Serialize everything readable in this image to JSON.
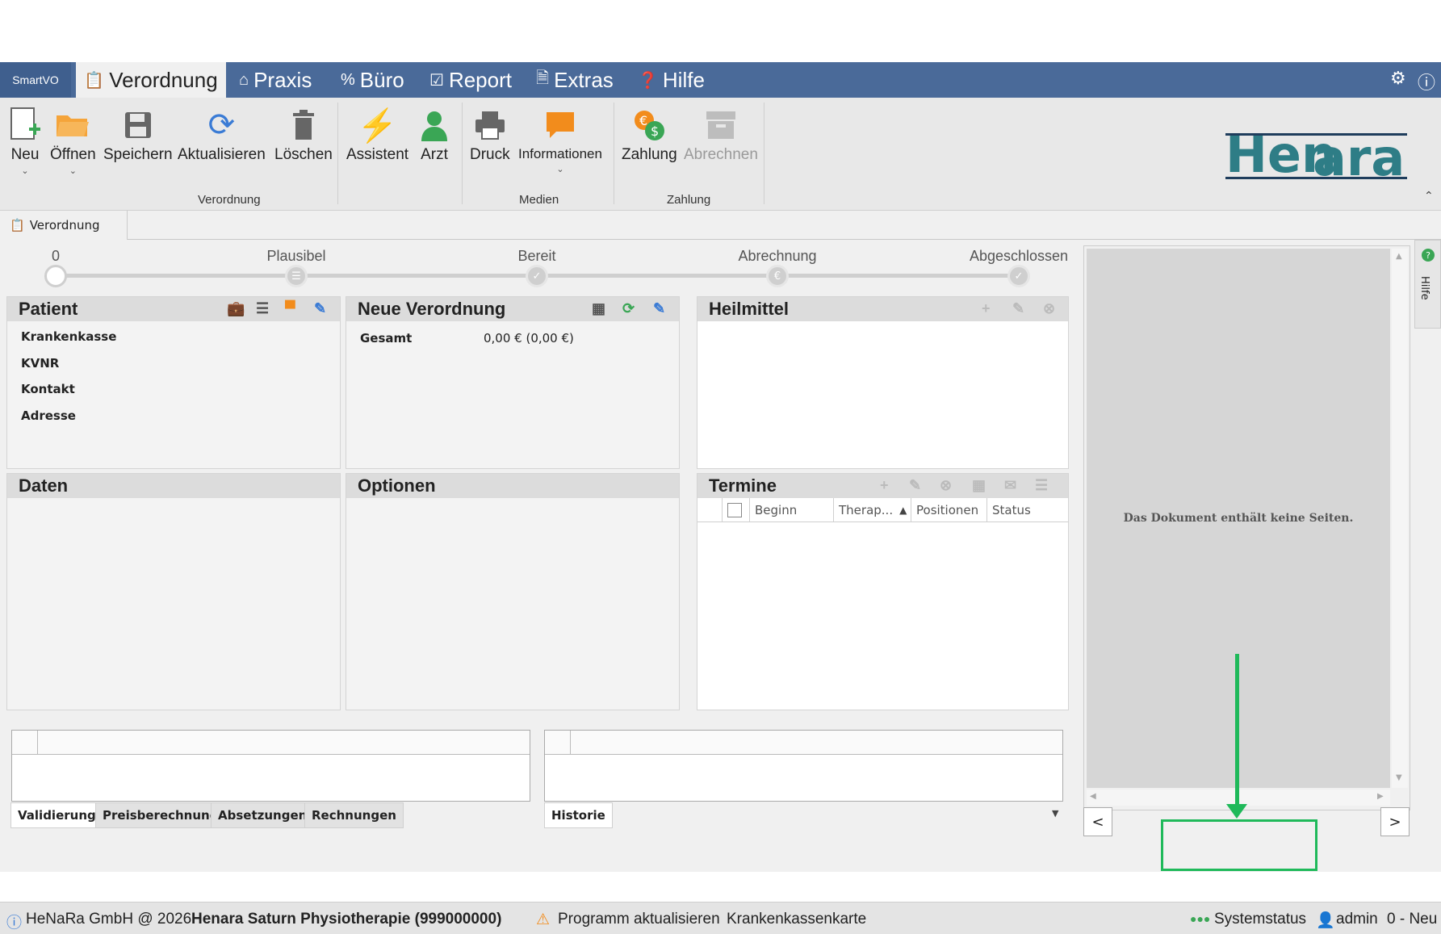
{
  "menubar": {
    "smartvo": "SmartVO",
    "tabs": [
      {
        "label": "Verordnung",
        "icon": "clipboard-icon"
      },
      {
        "label": "Praxis",
        "icon": "home-icon"
      },
      {
        "label": "Büro",
        "icon": "percent-icon"
      },
      {
        "label": "Report",
        "icon": "clipboard-check-icon"
      },
      {
        "label": "Extras",
        "icon": "document-search-icon"
      },
      {
        "label": "Hilfe",
        "icon": "help-icon"
      }
    ],
    "right_icons": [
      "gear-icon",
      "info-icon"
    ]
  },
  "ribbon": {
    "buttons": [
      {
        "label": "Neu",
        "icon": "new-document-icon"
      },
      {
        "label": "Öffnen",
        "icon": "folder-open-icon"
      },
      {
        "label": "Speichern",
        "icon": "save-icon"
      },
      {
        "label": "Aktualisieren",
        "icon": "refresh-icon"
      },
      {
        "label": "Löschen",
        "icon": "trash-icon"
      },
      {
        "label": "Assistent",
        "icon": "lightning-icon"
      },
      {
        "label": "Arzt",
        "icon": "doctor-icon"
      },
      {
        "label": "Druck",
        "icon": "printer-icon"
      },
      {
        "label": "Informationen",
        "icon": "chat-icon"
      },
      {
        "label": "Zahlung",
        "icon": "coins-icon"
      },
      {
        "label": "Abrechnen",
        "icon": "archive-icon"
      }
    ],
    "groups": [
      "Verordnung",
      "Medien",
      "Zahlung"
    ],
    "logo": "Henara"
  },
  "doc_tab": "Verordnung",
  "progress": {
    "steps": [
      "0",
      "Plausibel",
      "Bereit",
      "Abrechnung",
      "Abgeschlossen"
    ],
    "current": 0
  },
  "panels": {
    "patient": {
      "title": "Patient",
      "fields": [
        "Krankenkasse",
        "KVNR",
        "Kontakt",
        "Adresse"
      ]
    },
    "neue_verordnung": {
      "title": "Neue Verordnung",
      "gesamt_label": "Gesamt",
      "gesamt_value": "0,00 € (0,00 €)"
    },
    "heilmittel": {
      "title": "Heilmittel"
    },
    "daten": {
      "title": "Daten"
    },
    "optionen": {
      "title": "Optionen"
    },
    "termine": {
      "title": "Termine",
      "columns": [
        "Beginn",
        "Therap...",
        "Positionen",
        "Status"
      ]
    }
  },
  "bottom_tabs_left": [
    "Validierung",
    "Preisberechnung",
    "Absetzungen",
    "Rechnungen"
  ],
  "bottom_tabs_right": [
    "Historie"
  ],
  "preview": {
    "empty_text": "Das Dokument enthält keine Seiten.",
    "prev": "<",
    "next": ">",
    "side_help": "Hilfe"
  },
  "statusbar": {
    "company": "HeNaRa GmbH @ 2026",
    "practice": "Henara Saturn Physiotherapie (999000000)",
    "update": "Programm aktualisieren",
    "card": "Krankenkassenkarte",
    "systemstatus": "Systemstatus",
    "user": "admin",
    "mode": "0 - Neu"
  },
  "colors": {
    "menubar": "#4a6a99",
    "accent_orange": "#f28c1c",
    "accent_green": "#3aa655",
    "annotation": "#1fb95a"
  }
}
